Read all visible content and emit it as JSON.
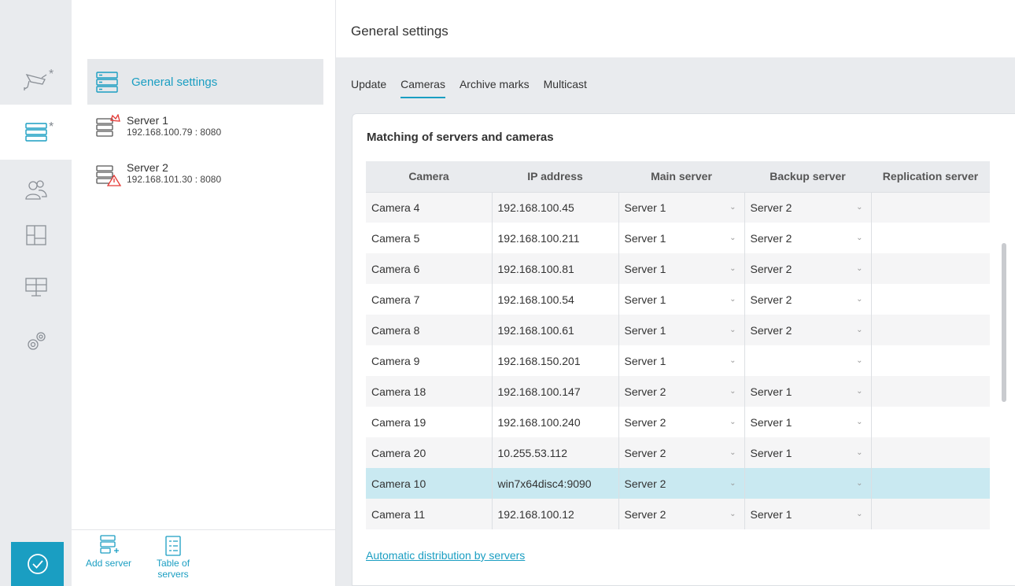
{
  "rail": {
    "items": [
      {
        "icon": "camera-icon",
        "star": "*"
      },
      {
        "icon": "server-icon",
        "star": "*"
      },
      {
        "icon": "users-icon",
        "star": ""
      },
      {
        "icon": "layout-icon",
        "star": ""
      },
      {
        "icon": "workstation-icon",
        "star": ""
      },
      {
        "icon": "gears-icon",
        "star": ""
      }
    ],
    "apply_icon": "check-circle-icon"
  },
  "tree": {
    "general_label": "General settings",
    "servers": [
      {
        "name": "Server 1",
        "address": "192.168.100.79 : 8080",
        "status": "crown"
      },
      {
        "name": "Server 2",
        "address": "192.168.101.30 : 8080",
        "status": "warning"
      }
    ],
    "add_server_label": "Add server",
    "table_of_servers_line1": "Table of",
    "table_of_servers_line2": "servers"
  },
  "main": {
    "title": "General settings",
    "tabs": [
      "Update",
      "Cameras",
      "Archive marks",
      "Multicast"
    ],
    "active_tab": "Cameras",
    "card_title": "Matching of servers and cameras",
    "columns": [
      "Camera",
      "IP address",
      "Main server",
      "Backup server",
      "Replication server"
    ],
    "rows": [
      {
        "camera": "Camera 4",
        "ip": "192.168.100.45",
        "main": "Server 1",
        "backup": "Server 2",
        "replication": ""
      },
      {
        "camera": "Camera 5",
        "ip": "192.168.100.211",
        "main": "Server 1",
        "backup": "Server 2",
        "replication": ""
      },
      {
        "camera": "Camera 6",
        "ip": "192.168.100.81",
        "main": "Server 1",
        "backup": "Server 2",
        "replication": ""
      },
      {
        "camera": "Camera 7",
        "ip": "192.168.100.54",
        "main": "Server 1",
        "backup": "Server 2",
        "replication": ""
      },
      {
        "camera": "Camera 8",
        "ip": "192.168.100.61",
        "main": "Server 1",
        "backup": "Server 2",
        "replication": ""
      },
      {
        "camera": "Camera 9",
        "ip": "192.168.150.201",
        "main": "Server 1",
        "backup": "",
        "replication": ""
      },
      {
        "camera": "Camera 18",
        "ip": "192.168.100.147",
        "main": "Server 2",
        "backup": "Server 1",
        "replication": ""
      },
      {
        "camera": "Camera 19",
        "ip": "192.168.100.240",
        "main": "Server 2",
        "backup": "Server 1",
        "replication": ""
      },
      {
        "camera": "Camera 20",
        "ip": "10.255.53.112",
        "main": "Server 2",
        "backup": "Server 1",
        "replication": ""
      },
      {
        "camera": "Camera 10",
        "ip": "win7x64disc4:9090",
        "main": "Server 2",
        "backup": "",
        "replication": ""
      },
      {
        "camera": "Camera 11",
        "ip": "192.168.100.12",
        "main": "Server 2",
        "backup": "Server 1",
        "replication": ""
      }
    ],
    "selected_row": 9,
    "auto_link": "Automatic distribution by servers"
  },
  "colors": {
    "accent": "#1a9ec2",
    "selected_row": "#c9e9f1",
    "warning": "#e53935"
  }
}
